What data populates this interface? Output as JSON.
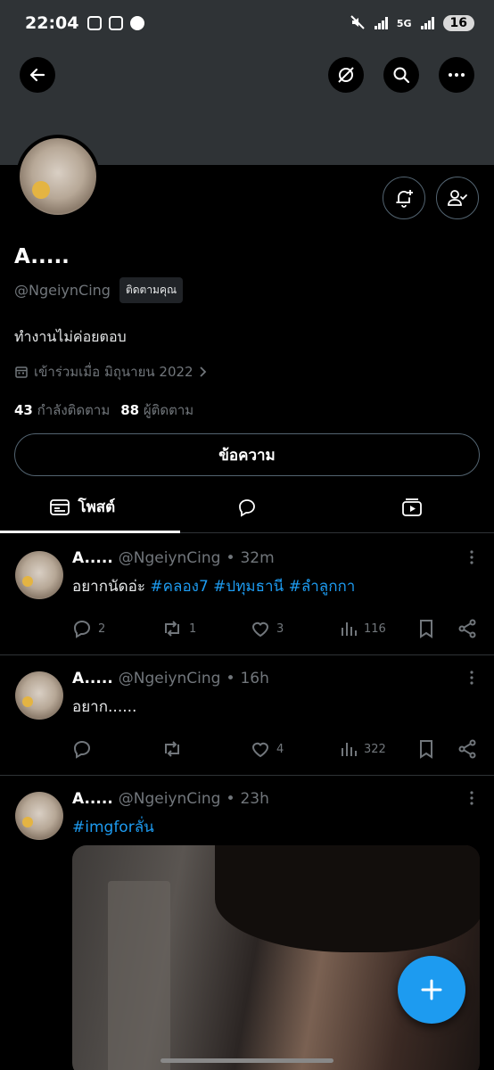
{
  "status_bar": {
    "time": "22:04",
    "network": "5G",
    "battery": "16"
  },
  "profile": {
    "name": "A.....",
    "handle": "@NgeiynCing",
    "follows_you": "ติดตามคุณ",
    "bio": "ทำงานไม่ค่อยตอบ",
    "joined": "เข้าร่วมเมื่อ มิถุนายน 2022",
    "following_count": "43",
    "following_label": "กำลังติดตาม",
    "followers_count": "88",
    "followers_label": "ผู้ติดตาม",
    "message_label": "ข้อความ"
  },
  "tabs": [
    {
      "label": "โพสต์",
      "active": true
    },
    {
      "label": "",
      "active": false
    },
    {
      "label": "",
      "active": false
    }
  ],
  "tweets": [
    {
      "name": "A.....",
      "handle": "@NgeiynCing",
      "time": "32m",
      "text_plain": "อยากนัดอ่ะ ",
      "hashtags": "#คลอง7 #ปทุมธานี #ลำลูกกา",
      "replies": "2",
      "retweets": "1",
      "likes": "3",
      "views": "116"
    },
    {
      "name": "A.....",
      "handle": "@NgeiynCing",
      "time": "16h",
      "text_plain": "อยาก......",
      "hashtags": "",
      "replies": "",
      "retweets": "",
      "likes": "4",
      "views": "322"
    },
    {
      "name": "A.....",
      "handle": "@NgeiynCing",
      "time": "23h",
      "text_plain": "",
      "hashtags": "#imgforลั่น"
    }
  ],
  "colors": {
    "accent": "#1d9bf0",
    "background": "#000000",
    "banner": "#2f3336",
    "muted_text": "#71767b"
  }
}
